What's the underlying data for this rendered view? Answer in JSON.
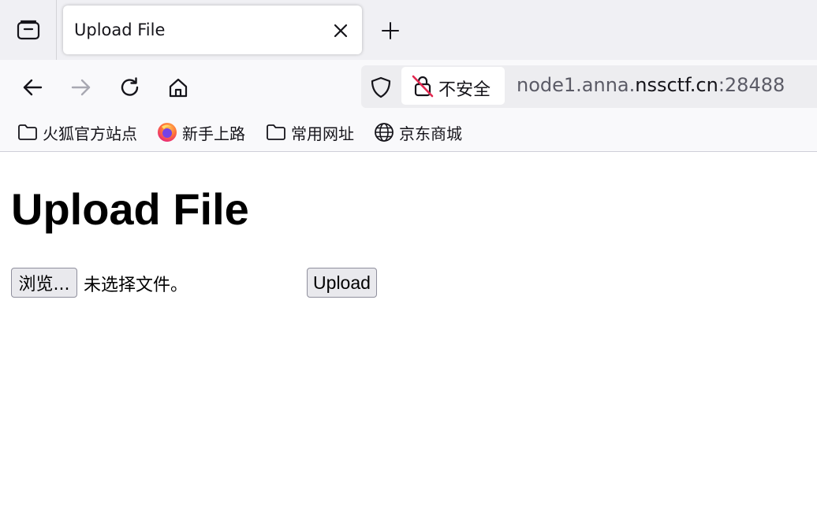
{
  "browser": {
    "tab": {
      "title": "Upload File"
    },
    "url": {
      "security_label": "不安全",
      "prefix": "node1.anna.",
      "domain": "nssctf.cn",
      "port": ":28488"
    },
    "bookmarks": [
      {
        "label": "火狐官方站点",
        "icon": "folder-icon"
      },
      {
        "label": "新手上路",
        "icon": "firefox-icon"
      },
      {
        "label": "常用网址",
        "icon": "folder-icon"
      },
      {
        "label": "京东商城",
        "icon": "globe-icon"
      }
    ]
  },
  "page": {
    "title": "Upload File",
    "form": {
      "browse_label": "浏览...",
      "no_file_label": "未选择文件。",
      "upload_label": "Upload"
    }
  },
  "colors": {
    "tabstrip_bg": "#f0f0f4",
    "toolbar_bg": "#f9f9fb",
    "urlbar_bg": "#ededf0",
    "insecure_red": "#e22850",
    "firefox_orange": "#ff7139"
  }
}
